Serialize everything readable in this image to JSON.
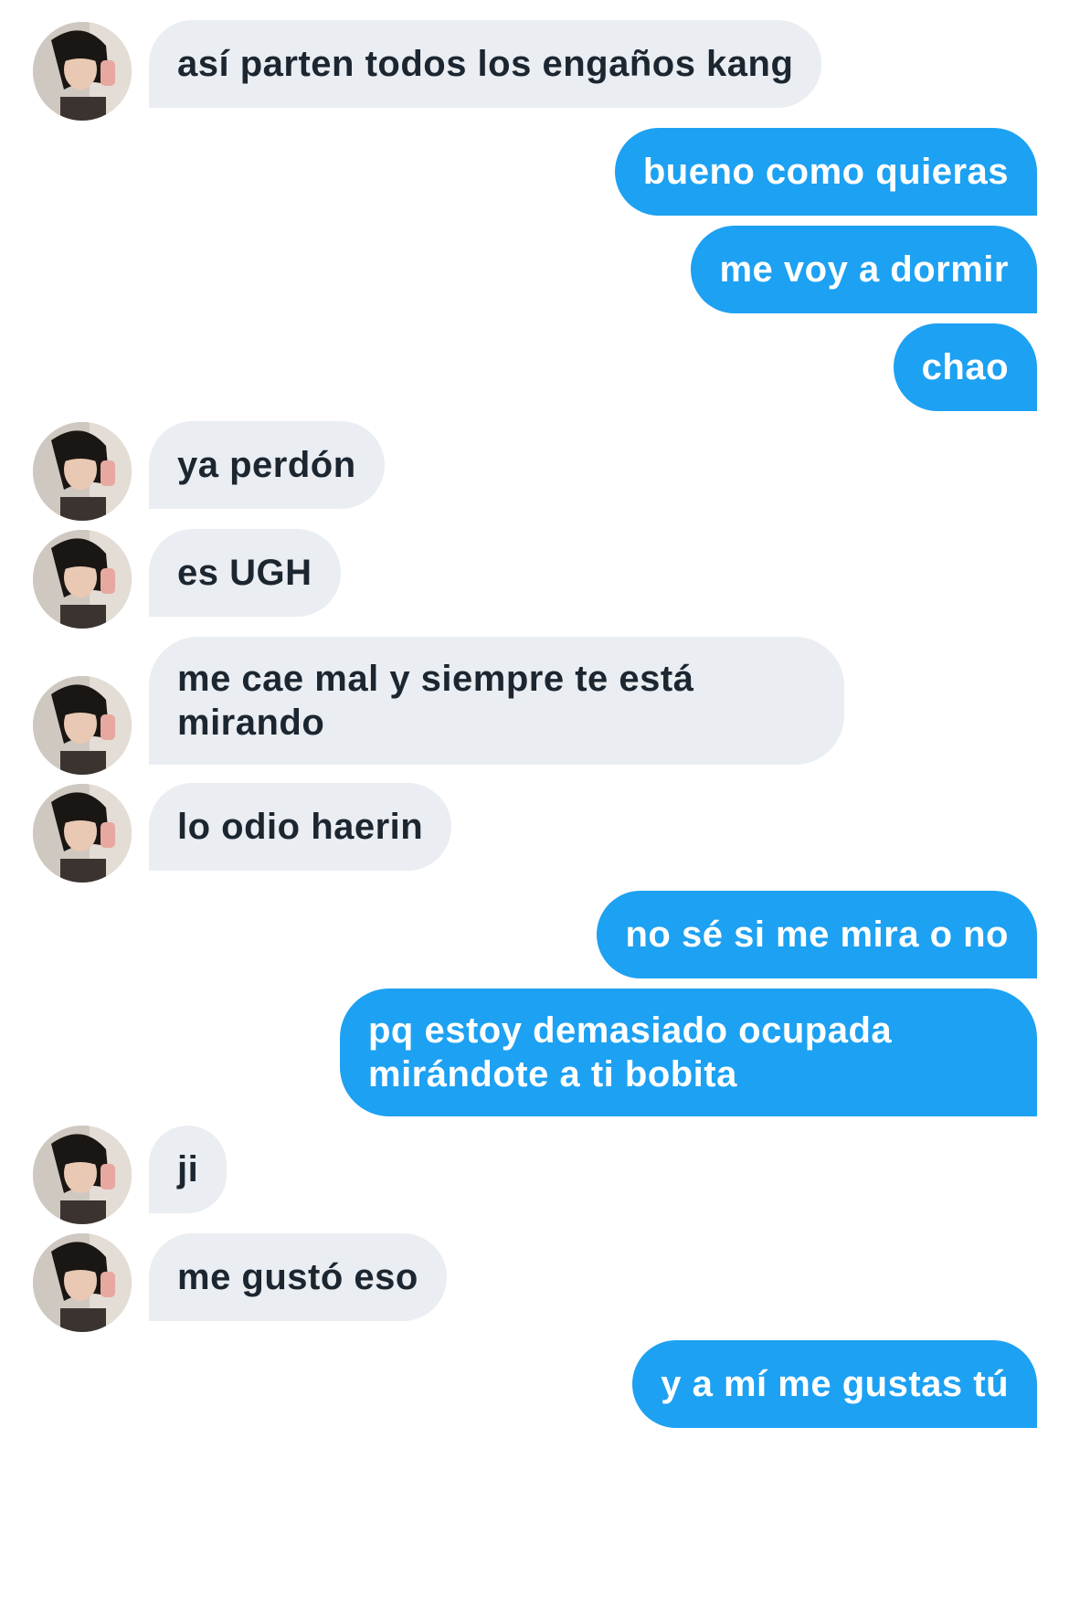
{
  "messages": [
    {
      "from": "them",
      "text": "así parten todos los engaños kang"
    },
    {
      "from": "me",
      "text": "bueno como quieras"
    },
    {
      "from": "me",
      "text": "me voy a dormir"
    },
    {
      "from": "me",
      "text": "chao"
    },
    {
      "from": "them",
      "text": "ya perdón"
    },
    {
      "from": "them",
      "text": "es UGH"
    },
    {
      "from": "them",
      "text": "me cae mal y siempre te está mirando"
    },
    {
      "from": "them",
      "text": "lo odio haerin"
    },
    {
      "from": "me",
      "text": "no sé si me mira o no"
    },
    {
      "from": "me",
      "text": "pq estoy demasiado ocupada mirándote a ti bobita"
    },
    {
      "from": "them",
      "text": "ji"
    },
    {
      "from": "them",
      "text": "me gustó eso"
    },
    {
      "from": "me",
      "text": "y a mí me gustas tú"
    }
  ],
  "avatar_icon": "profile-photo-avatar-icon",
  "colors": {
    "sent_bubble": "#1da1f2",
    "sent_text": "#ffffff",
    "received_bubble": "#eaedf1",
    "received_text": "#1c2630",
    "background": "#ffffff"
  }
}
